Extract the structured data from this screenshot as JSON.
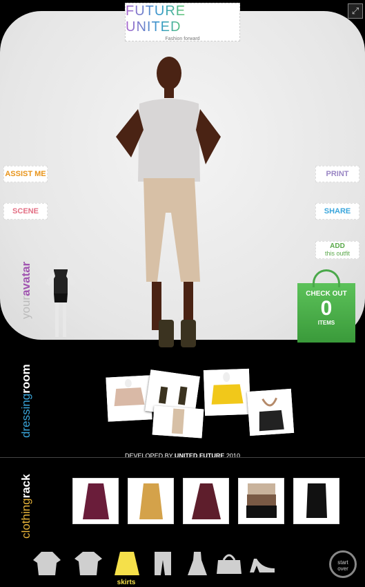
{
  "logo": {
    "brand": "FUTURE UNITED",
    "tagline": "Fashion forward"
  },
  "expand_icon": "expand-icon",
  "buttons": {
    "assist": "ASSIST ME",
    "scene": "SCENE",
    "print": "PRINT",
    "share": "SHARE",
    "add": "ADD",
    "add_sub": "this outfit"
  },
  "labels": {
    "your": "your",
    "avatar": "avatar",
    "dressing": "dressing",
    "room": "room",
    "clothing": "clothing",
    "rack": "rack"
  },
  "checkout": {
    "title": "CHECK OUT",
    "count": "0",
    "items": "ITEMS"
  },
  "footer": {
    "developed_prefix": "DEVELOPED BY ",
    "developed_name": "UNITED FUTURE",
    "developed_year": " 2010"
  },
  "category_selected": "skirts",
  "start_over": {
    "line1": "start",
    "line2": "over"
  },
  "colors": {
    "stage": "#e6e6e6",
    "background": "#000000",
    "checkout_green": "#4caf50",
    "accent_yellow": "#f5e04a"
  }
}
